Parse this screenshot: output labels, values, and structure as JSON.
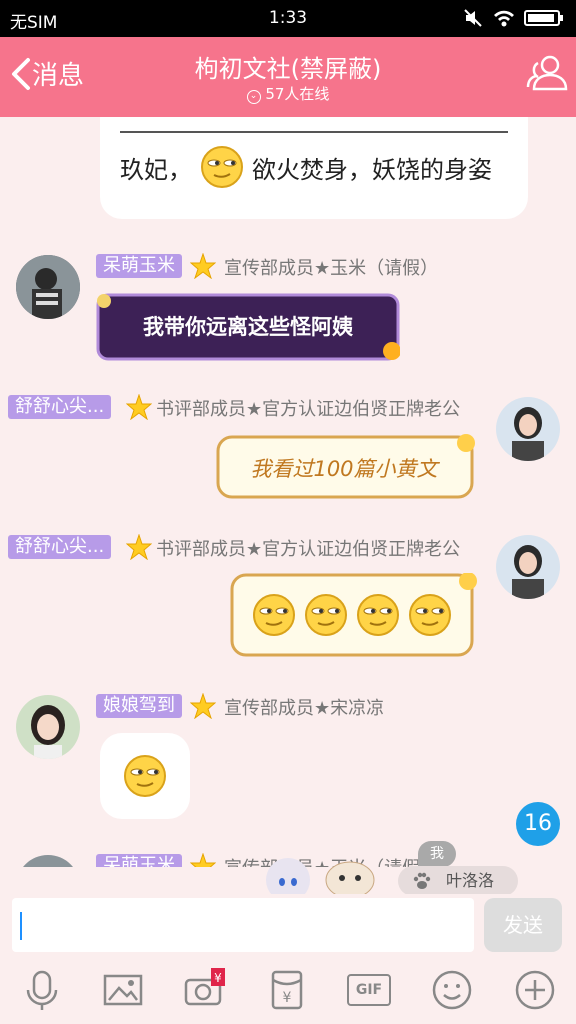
{
  "status": {
    "carrier": "无SIM",
    "time": "1:33"
  },
  "header": {
    "back_label": "消息",
    "title": "枸初文社(禁屏蔽)",
    "online": "57人在线"
  },
  "messages": [
    {
      "text": "玖妃，",
      "text2": "欲火焚身，妖饶的身姿"
    },
    {
      "nick": "呆萌玉米",
      "role": "宣传部成员★玉米（请假）",
      "sticker": "我带你远离这些怪阿姨"
    },
    {
      "nick": "舒舒心尖...",
      "role": "书评部成员★官方认证边伯贤正牌老公",
      "sticker": "我看过100篇小黄文"
    },
    {
      "nick": "舒舒心尖...",
      "role": "书评部成员★官方认证边伯贤正牌老公"
    },
    {
      "nick": "娘娘驾到",
      "role": "宣传部成员★宋凉凉"
    },
    {
      "nick": "呆萌玉米",
      "role": "宣传部成员★玉米（请假）"
    }
  ],
  "unread_badge": "16",
  "mention": {
    "me": "我",
    "name": "叶洛洛"
  },
  "input": {
    "send_label": "发送"
  },
  "toolbar": {
    "gif_label": "GIF"
  },
  "colors": {
    "header": "#f6748c",
    "nick_bg": "#b79be8",
    "badge": "#1fa0e8"
  }
}
